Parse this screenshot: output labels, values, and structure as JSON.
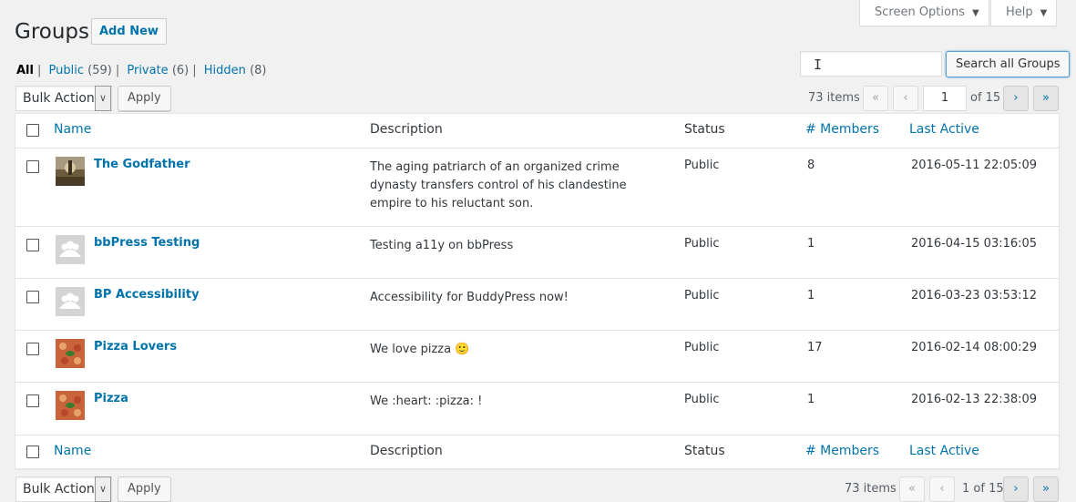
{
  "screen_meta": {
    "screen_options": "Screen Options",
    "help": "Help"
  },
  "page": {
    "title": "Groups",
    "add_new": "Add New"
  },
  "filters": [
    {
      "label": "All",
      "count": ""
    },
    {
      "label": "Public",
      "count": "(59)"
    },
    {
      "label": "Private",
      "count": "(6)"
    },
    {
      "label": "Hidden",
      "count": "(8)"
    }
  ],
  "search": {
    "value": "",
    "button": "Search all Groups"
  },
  "bulk": {
    "select": "Bulk Actions",
    "apply": "Apply"
  },
  "pagination": {
    "items": "73 items",
    "first": "«",
    "prev": "‹",
    "next": "›",
    "last": "»",
    "current": "1",
    "of": "of 15"
  },
  "columns": {
    "name": "Name",
    "description": "Description",
    "status": "Status",
    "members": "# Members",
    "last_active": "Last Active"
  },
  "rows": [
    {
      "name": "The Godfather",
      "description": "The aging patriarch of an organized crime dynasty transfers control of his clandestine empire to his reluctant son.",
      "status": "Public",
      "members": "8",
      "last_active": "2016-05-11 22:05:09",
      "avatar": "photo-godfather"
    },
    {
      "name": "bbPress Testing",
      "description": "Testing a11y on bbPress",
      "status": "Public",
      "members": "1",
      "last_active": "2016-04-15 03:16:05",
      "avatar": "group-placeholder"
    },
    {
      "name": "BP Accessibility",
      "description": "Accessibility for BuddyPress now!",
      "status": "Public",
      "members": "1",
      "last_active": "2016-03-23 03:53:12",
      "avatar": "group-placeholder"
    },
    {
      "name": "Pizza Lovers",
      "description": "We love pizza",
      "emoji": "🙂",
      "status": "Public",
      "members": "17",
      "last_active": "2016-02-14 08:00:29",
      "avatar": "photo-pizza"
    },
    {
      "name": "Pizza",
      "description": "We :heart: :pizza: !",
      "status": "Public",
      "members": "1",
      "last_active": "2016-02-13 22:38:09",
      "avatar": "photo-pizza"
    }
  ],
  "colors": {
    "link": "#0073aa",
    "background": "#f1f1f1",
    "text": "#23282d"
  }
}
